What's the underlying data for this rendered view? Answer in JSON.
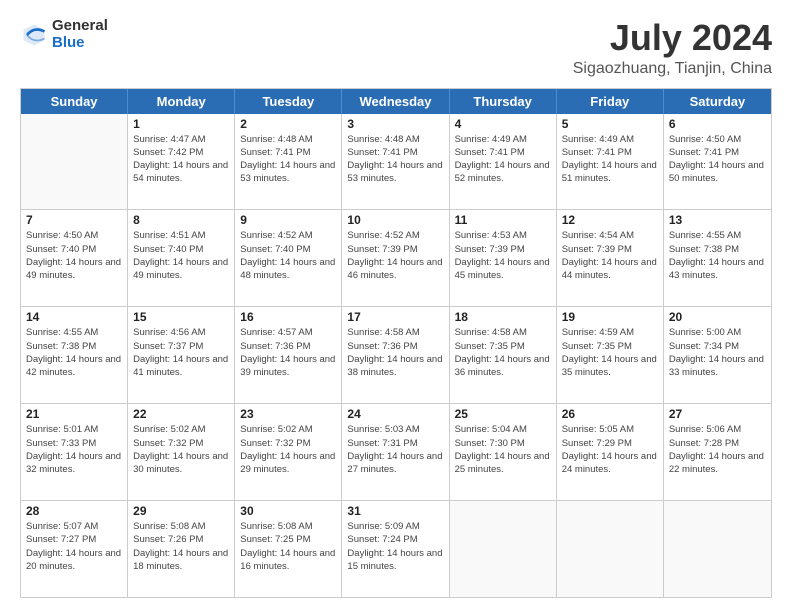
{
  "logo": {
    "general": "General",
    "blue": "Blue"
  },
  "title": "July 2024",
  "subtitle": "Sigaozhuang, Tianjin, China",
  "days_of_week": [
    "Sunday",
    "Monday",
    "Tuesday",
    "Wednesday",
    "Thursday",
    "Friday",
    "Saturday"
  ],
  "weeks": [
    [
      {
        "day": "",
        "sunrise": "",
        "sunset": "",
        "daylight": "",
        "empty": true
      },
      {
        "day": "1",
        "sunrise": "Sunrise: 4:47 AM",
        "sunset": "Sunset: 7:42 PM",
        "daylight": "Daylight: 14 hours and 54 minutes."
      },
      {
        "day": "2",
        "sunrise": "Sunrise: 4:48 AM",
        "sunset": "Sunset: 7:41 PM",
        "daylight": "Daylight: 14 hours and 53 minutes."
      },
      {
        "day": "3",
        "sunrise": "Sunrise: 4:48 AM",
        "sunset": "Sunset: 7:41 PM",
        "daylight": "Daylight: 14 hours and 53 minutes."
      },
      {
        "day": "4",
        "sunrise": "Sunrise: 4:49 AM",
        "sunset": "Sunset: 7:41 PM",
        "daylight": "Daylight: 14 hours and 52 minutes."
      },
      {
        "day": "5",
        "sunrise": "Sunrise: 4:49 AM",
        "sunset": "Sunset: 7:41 PM",
        "daylight": "Daylight: 14 hours and 51 minutes."
      },
      {
        "day": "6",
        "sunrise": "Sunrise: 4:50 AM",
        "sunset": "Sunset: 7:41 PM",
        "daylight": "Daylight: 14 hours and 50 minutes."
      }
    ],
    [
      {
        "day": "7",
        "sunrise": "Sunrise: 4:50 AM",
        "sunset": "Sunset: 7:40 PM",
        "daylight": "Daylight: 14 hours and 49 minutes."
      },
      {
        "day": "8",
        "sunrise": "Sunrise: 4:51 AM",
        "sunset": "Sunset: 7:40 PM",
        "daylight": "Daylight: 14 hours and 49 minutes."
      },
      {
        "day": "9",
        "sunrise": "Sunrise: 4:52 AM",
        "sunset": "Sunset: 7:40 PM",
        "daylight": "Daylight: 14 hours and 48 minutes."
      },
      {
        "day": "10",
        "sunrise": "Sunrise: 4:52 AM",
        "sunset": "Sunset: 7:39 PM",
        "daylight": "Daylight: 14 hours and 46 minutes."
      },
      {
        "day": "11",
        "sunrise": "Sunrise: 4:53 AM",
        "sunset": "Sunset: 7:39 PM",
        "daylight": "Daylight: 14 hours and 45 minutes."
      },
      {
        "day": "12",
        "sunrise": "Sunrise: 4:54 AM",
        "sunset": "Sunset: 7:39 PM",
        "daylight": "Daylight: 14 hours and 44 minutes."
      },
      {
        "day": "13",
        "sunrise": "Sunrise: 4:55 AM",
        "sunset": "Sunset: 7:38 PM",
        "daylight": "Daylight: 14 hours and 43 minutes."
      }
    ],
    [
      {
        "day": "14",
        "sunrise": "Sunrise: 4:55 AM",
        "sunset": "Sunset: 7:38 PM",
        "daylight": "Daylight: 14 hours and 42 minutes."
      },
      {
        "day": "15",
        "sunrise": "Sunrise: 4:56 AM",
        "sunset": "Sunset: 7:37 PM",
        "daylight": "Daylight: 14 hours and 41 minutes."
      },
      {
        "day": "16",
        "sunrise": "Sunrise: 4:57 AM",
        "sunset": "Sunset: 7:36 PM",
        "daylight": "Daylight: 14 hours and 39 minutes."
      },
      {
        "day": "17",
        "sunrise": "Sunrise: 4:58 AM",
        "sunset": "Sunset: 7:36 PM",
        "daylight": "Daylight: 14 hours and 38 minutes."
      },
      {
        "day": "18",
        "sunrise": "Sunrise: 4:58 AM",
        "sunset": "Sunset: 7:35 PM",
        "daylight": "Daylight: 14 hours and 36 minutes."
      },
      {
        "day": "19",
        "sunrise": "Sunrise: 4:59 AM",
        "sunset": "Sunset: 7:35 PM",
        "daylight": "Daylight: 14 hours and 35 minutes."
      },
      {
        "day": "20",
        "sunrise": "Sunrise: 5:00 AM",
        "sunset": "Sunset: 7:34 PM",
        "daylight": "Daylight: 14 hours and 33 minutes."
      }
    ],
    [
      {
        "day": "21",
        "sunrise": "Sunrise: 5:01 AM",
        "sunset": "Sunset: 7:33 PM",
        "daylight": "Daylight: 14 hours and 32 minutes."
      },
      {
        "day": "22",
        "sunrise": "Sunrise: 5:02 AM",
        "sunset": "Sunset: 7:32 PM",
        "daylight": "Daylight: 14 hours and 30 minutes."
      },
      {
        "day": "23",
        "sunrise": "Sunrise: 5:02 AM",
        "sunset": "Sunset: 7:32 PM",
        "daylight": "Daylight: 14 hours and 29 minutes."
      },
      {
        "day": "24",
        "sunrise": "Sunrise: 5:03 AM",
        "sunset": "Sunset: 7:31 PM",
        "daylight": "Daylight: 14 hours and 27 minutes."
      },
      {
        "day": "25",
        "sunrise": "Sunrise: 5:04 AM",
        "sunset": "Sunset: 7:30 PM",
        "daylight": "Daylight: 14 hours and 25 minutes."
      },
      {
        "day": "26",
        "sunrise": "Sunrise: 5:05 AM",
        "sunset": "Sunset: 7:29 PM",
        "daylight": "Daylight: 14 hours and 24 minutes."
      },
      {
        "day": "27",
        "sunrise": "Sunrise: 5:06 AM",
        "sunset": "Sunset: 7:28 PM",
        "daylight": "Daylight: 14 hours and 22 minutes."
      }
    ],
    [
      {
        "day": "28",
        "sunrise": "Sunrise: 5:07 AM",
        "sunset": "Sunset: 7:27 PM",
        "daylight": "Daylight: 14 hours and 20 minutes."
      },
      {
        "day": "29",
        "sunrise": "Sunrise: 5:08 AM",
        "sunset": "Sunset: 7:26 PM",
        "daylight": "Daylight: 14 hours and 18 minutes."
      },
      {
        "day": "30",
        "sunrise": "Sunrise: 5:08 AM",
        "sunset": "Sunset: 7:25 PM",
        "daylight": "Daylight: 14 hours and 16 minutes."
      },
      {
        "day": "31",
        "sunrise": "Sunrise: 5:09 AM",
        "sunset": "Sunset: 7:24 PM",
        "daylight": "Daylight: 14 hours and 15 minutes."
      },
      {
        "day": "",
        "sunrise": "",
        "sunset": "",
        "daylight": "",
        "empty": true
      },
      {
        "day": "",
        "sunrise": "",
        "sunset": "",
        "daylight": "",
        "empty": true
      },
      {
        "day": "",
        "sunrise": "",
        "sunset": "",
        "daylight": "",
        "empty": true
      }
    ]
  ],
  "colors": {
    "header_bg": "#2a6db5",
    "header_text": "#ffffff",
    "border": "#cccccc"
  }
}
